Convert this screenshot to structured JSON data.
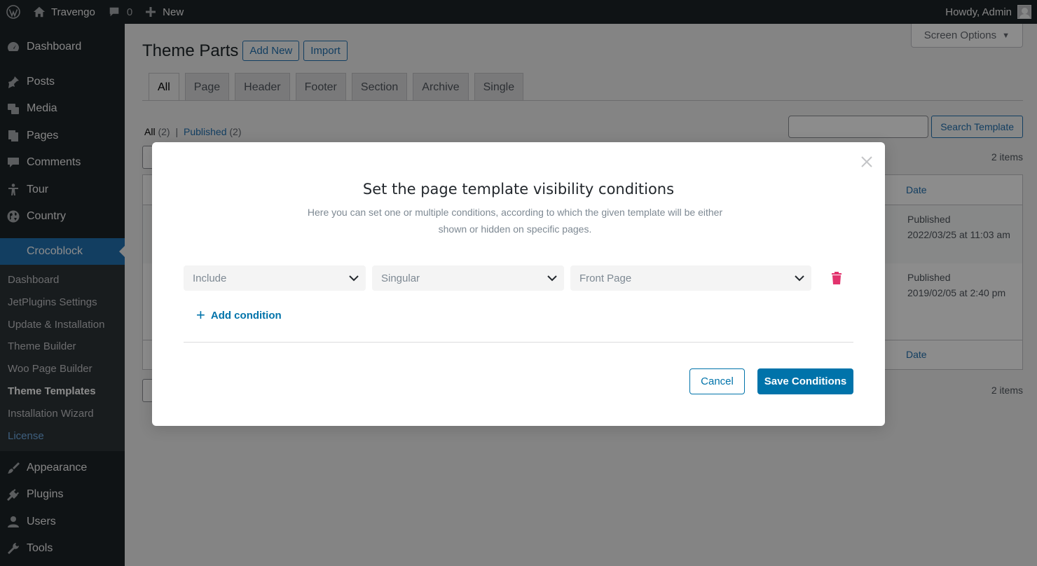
{
  "adminbar": {
    "site_name": "Travengo",
    "comments_count": "0",
    "new_label": "New",
    "greeting": "Howdy, Admin"
  },
  "sidebar": {
    "items": [
      {
        "label": "Dashboard",
        "icon": "dashboard-icon"
      },
      {
        "label": "Posts",
        "icon": "pin-icon"
      },
      {
        "label": "Media",
        "icon": "media-icon"
      },
      {
        "label": "Pages",
        "icon": "pages-icon"
      },
      {
        "label": "Comments",
        "icon": "comment-icon"
      },
      {
        "label": "Tour",
        "icon": "person-icon"
      },
      {
        "label": "Country",
        "icon": "globe-icon"
      },
      {
        "label": "Crocoblock",
        "icon": "crocoblock-icon"
      },
      {
        "label": "Appearance",
        "icon": "brush-icon"
      },
      {
        "label": "Plugins",
        "icon": "plug-icon"
      },
      {
        "label": "Users",
        "icon": "user-icon"
      },
      {
        "label": "Tools",
        "icon": "wrench-icon"
      }
    ],
    "submenu": [
      "Dashboard",
      "JetPlugins Settings",
      "Update & Installation",
      "Theme Builder",
      "Woo Page Builder",
      "Theme Templates",
      "Installation Wizard",
      "License"
    ]
  },
  "main": {
    "screen_options": "Screen Options",
    "title": "Theme Parts",
    "add_new": "Add New",
    "import": "Import",
    "tabs": [
      "All",
      "Page",
      "Header",
      "Footer",
      "Section",
      "Archive",
      "Single"
    ],
    "filter_all": "All",
    "filter_all_count": "(2)",
    "filter_sep": "|",
    "filter_published": "Published",
    "filter_published_count": "(2)",
    "search_button": "Search Template",
    "items_count": "2 items",
    "column_date": "Date",
    "rows": [
      {
        "status": "Published",
        "date": "2022/03/25 at 11:03 am"
      },
      {
        "status": "Published",
        "date": "2019/02/05 at 2:40 pm"
      }
    ]
  },
  "modal": {
    "title": "Set the page template visibility conditions",
    "description_line1": "Here you can set one or multiple conditions, according to which the given template will be either",
    "description_line2": "shown or hidden on specific pages.",
    "condition": {
      "type": "Include",
      "group": "Singular",
      "target": "Front Page"
    },
    "add_condition": "Add condition",
    "cancel": "Cancel",
    "save": "Save Conditions"
  },
  "colors": {
    "accent": "#0073aa",
    "delete": "#d6336c",
    "sidebar_bg": "#1d2327",
    "sidebar_active": "#2271b1"
  }
}
